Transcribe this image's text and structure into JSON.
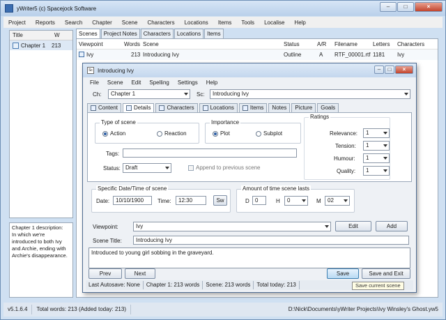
{
  "main": {
    "title": "yWriter5 (c) Spacejock Software",
    "window_buttons": [
      "–",
      "□",
      "×"
    ],
    "menu": [
      "Project",
      "Reports",
      "Search",
      "Chapter",
      "Scene",
      "Characters",
      "Locations",
      "Items",
      "Tools",
      "Localise",
      "Help"
    ],
    "chapter_list": {
      "headers": [
        "Title",
        "W"
      ],
      "rows": [
        {
          "title": "Chapter 1",
          "words": "213"
        }
      ]
    },
    "chapter_description": "Chapter 1 description:\nIn which we're introduced to both Ivy and Archie, ending with Archie's disappearance.",
    "scene_tabs": [
      "Scenes",
      "Project Notes",
      "Characters",
      "Locations",
      "Items"
    ],
    "scene_grid": {
      "headers": [
        "Viewpoint",
        "Words",
        "Scene",
        "Status",
        "A/R",
        "Filename",
        "Letters",
        "Characters"
      ],
      "row": [
        "Ivy",
        "213",
        "Introducing Ivy",
        "Outline",
        "A",
        "RTF_00001.rtf",
        "1181",
        "Ivy"
      ]
    },
    "statusbar": {
      "version": "v5.1.6.4",
      "total": "Total words: 213 (Added today: 213)",
      "path": "D:\\Nick\\Documents\\yWriter Projects\\Ivy Winsley's Ghost.yw5"
    }
  },
  "dialog": {
    "title": "Introducing Ivy",
    "menu": [
      "File",
      "Scene",
      "Edit",
      "Spelling",
      "Settings",
      "Help"
    ],
    "ch_label": "Ch:",
    "ch_value": "Chapter 1",
    "sc_label": "Sc:",
    "sc_value": "Introducing Ivy",
    "tabs": [
      "Content",
      "Details",
      "Characters",
      "Locations",
      "Items",
      "Notes",
      "Picture",
      "Goals"
    ],
    "type_of_scene": {
      "title": "Type of scene",
      "options": [
        "Action",
        "Reaction"
      ],
      "selected": "Action"
    },
    "importance": {
      "title": "Importance",
      "options": [
        "Plot",
        "Subplot"
      ],
      "selected": "Plot"
    },
    "tags_label": "Tags:",
    "tags_value": "",
    "status_label": "Status:",
    "status_value": "Draft",
    "append_label": "Append to previous scene",
    "ratings": {
      "title": "Ratings",
      "items": [
        {
          "label": "Relevance:",
          "value": "1"
        },
        {
          "label": "Tension:",
          "value": "1"
        },
        {
          "label": "Humour:",
          "value": "1"
        },
        {
          "label": "Quality:",
          "value": "1"
        }
      ]
    },
    "date_time": {
      "title": "Specific Date/Time of scene",
      "date_label": "Date:",
      "date_value": "10/10/1900",
      "time_label": "Time:",
      "time_value": "12:30",
      "sw": "Sw"
    },
    "duration": {
      "title": "Amount of time scene lasts",
      "d_label": "D",
      "d_value": "0",
      "h_label": "H",
      "h_value": "0",
      "m_label": "M",
      "m_value": "02"
    },
    "viewpoint_label": "Viewpoint:",
    "viewpoint_value": "Ivy",
    "edit_btn": "Edit",
    "add_btn": "Add",
    "scene_title_label": "Scene Title:",
    "scene_title_value": "Introducing Ivy",
    "summary": "Introduced to young girl sobbing in the graveyard.",
    "prev_btn": "Prev",
    "next_btn": "Next",
    "save_btn": "Save",
    "save_exit_btn": "Save and Exit",
    "status": [
      "Last Autosave: None",
      "Chapter 1: 213 words",
      "Scene: 213 words",
      "Total today: 213"
    ],
    "tooltip": "Save current scene"
  }
}
